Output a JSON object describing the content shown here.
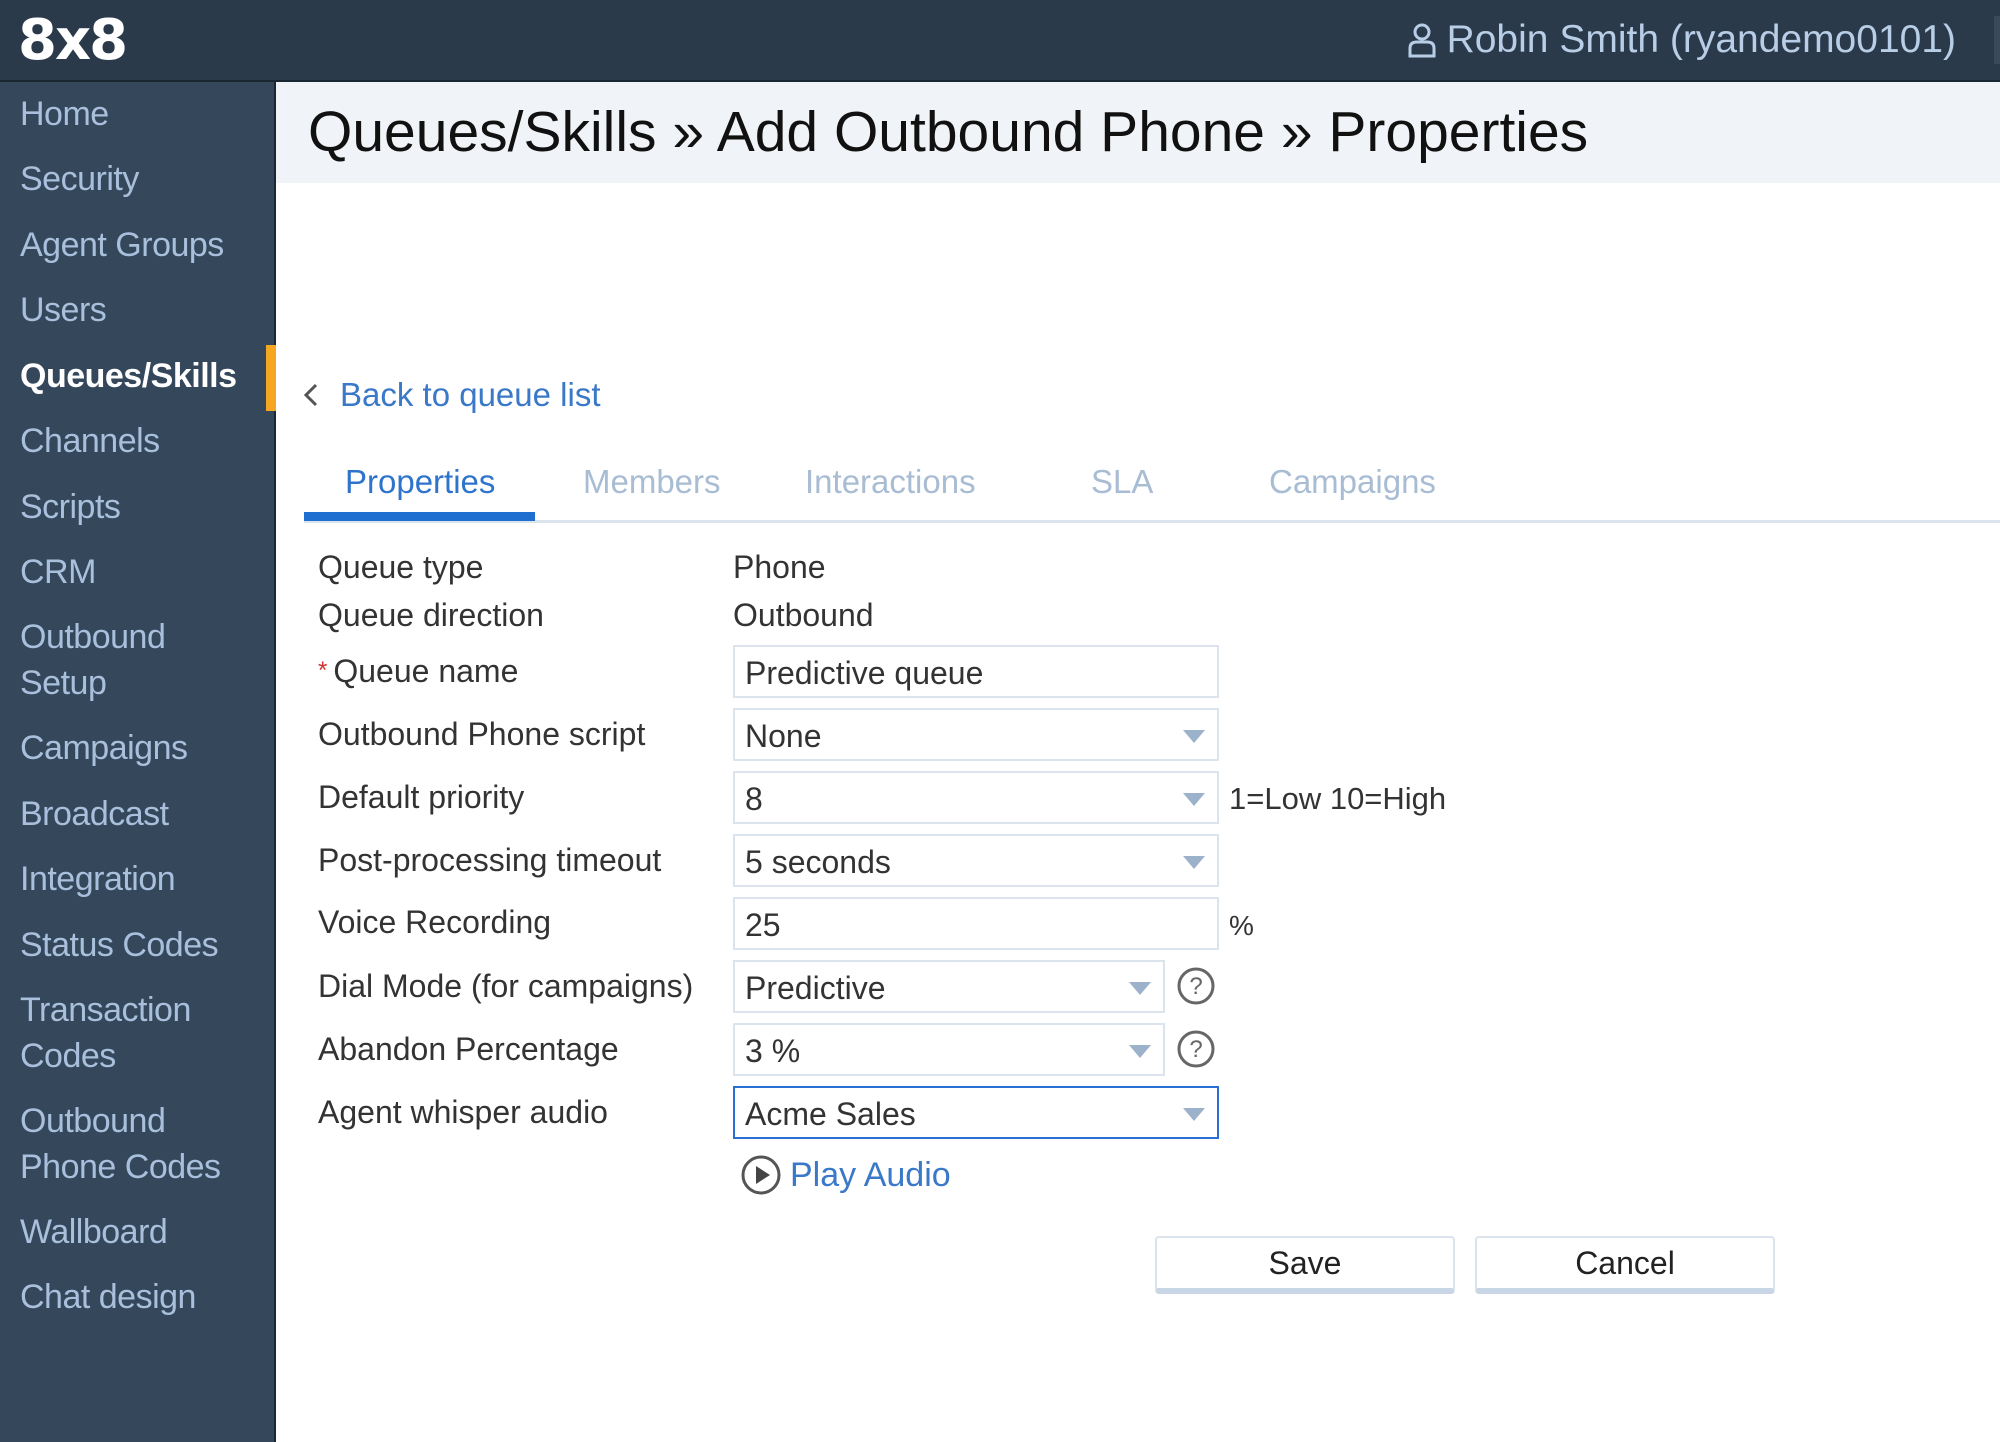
{
  "header": {
    "logo": "8x8",
    "user_label": "Robin Smith (ryandemo0101)",
    "user_icon": "person-icon"
  },
  "sidebar": {
    "active_index": 4,
    "accent_color": "#f5a623",
    "items": [
      {
        "label": "Home"
      },
      {
        "label": "Security"
      },
      {
        "label": "Agent Groups"
      },
      {
        "label": "Users"
      },
      {
        "label": "Queues/Skills"
      },
      {
        "label": "Channels"
      },
      {
        "label": "Scripts"
      },
      {
        "label": "CRM"
      },
      {
        "label": "Outbound Setup"
      },
      {
        "label": "Campaigns"
      },
      {
        "label": "Broadcast"
      },
      {
        "label": "Integration"
      },
      {
        "label": "Status Codes"
      },
      {
        "label": "Transaction Codes"
      },
      {
        "label": "Outbound Phone Codes"
      },
      {
        "label": "Wallboard"
      },
      {
        "label": "Chat design"
      }
    ]
  },
  "page": {
    "title": "Queues/Skills » Add Outbound Phone » Properties",
    "back_link": "Back to queue list"
  },
  "tabs": [
    {
      "label": "Properties",
      "active": true
    },
    {
      "label": "Members",
      "active": false
    },
    {
      "label": "Interactions",
      "active": false
    },
    {
      "label": "SLA",
      "active": false
    },
    {
      "label": "Campaigns",
      "active": false
    }
  ],
  "form": {
    "queue_type": {
      "label": "Queue type",
      "value": "Phone"
    },
    "queue_direction": {
      "label": "Queue direction",
      "value": "Outbound"
    },
    "queue_name": {
      "label": "Queue name",
      "required_mark": "*",
      "value": "Predictive queue"
    },
    "outbound_script": {
      "label": "Outbound Phone script",
      "value": "None"
    },
    "default_priority": {
      "label": "Default priority",
      "value": "8",
      "hint": "1=Low 10=High"
    },
    "post_processing": {
      "label": "Post-processing timeout",
      "value": "5 seconds"
    },
    "voice_recording": {
      "label": "Voice Recording",
      "value": "25",
      "unit": "%"
    },
    "dial_mode": {
      "label": "Dial Mode (for campaigns)",
      "value": "Predictive"
    },
    "abandon_percentage": {
      "label": "Abandon Percentage",
      "value": "3 %"
    },
    "agent_whisper": {
      "label": "Agent whisper audio",
      "value": "Acme Sales"
    },
    "play_audio": "Play Audio"
  },
  "buttons": {
    "save": "Save",
    "cancel": "Cancel"
  }
}
